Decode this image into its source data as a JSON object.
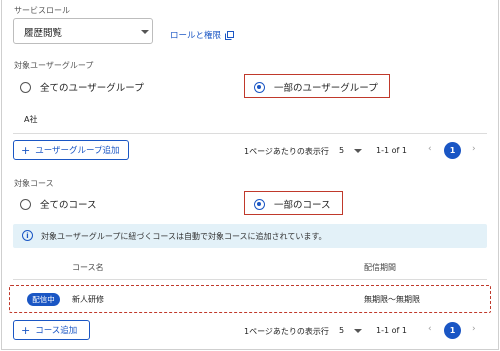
{
  "service_role": {
    "label": "サービスロール",
    "selected": "履歴閲覧",
    "roles_link": "ロールと権限"
  },
  "user_groups": {
    "label": "対象ユーザーグループ",
    "option_all": "全てのユーザーグループ",
    "option_some": "一部のユーザーグループ",
    "selected_option": "some",
    "items": [
      "A社"
    ],
    "add_button": "ユーザーグループ追加",
    "pagination": {
      "rows_label": "1ページあたりの表示行",
      "rows_value": "5",
      "range": "1-1 of 1",
      "current_page": "1"
    }
  },
  "courses": {
    "label": "対象コース",
    "option_all": "全てのコース",
    "option_some": "一部のコース",
    "selected_option": "some",
    "info_text": "対象ユーザーグループに紐づくコースは自動で対象コースに追加されています。",
    "columns": {
      "name": "コース名",
      "period": "配信期間"
    },
    "rows": [
      {
        "status": "配信中",
        "name": "新人研修",
        "period": "無期限～無期限"
      }
    ],
    "add_button": "コース追加",
    "pagination": {
      "rows_label": "1ページあたりの表示行",
      "rows_value": "5",
      "range": "1-1 of 1",
      "current_page": "1"
    }
  },
  "colors": {
    "accent": "#1a56c4",
    "highlight": "#c0392b",
    "info_bg": "#e3f1f8"
  }
}
